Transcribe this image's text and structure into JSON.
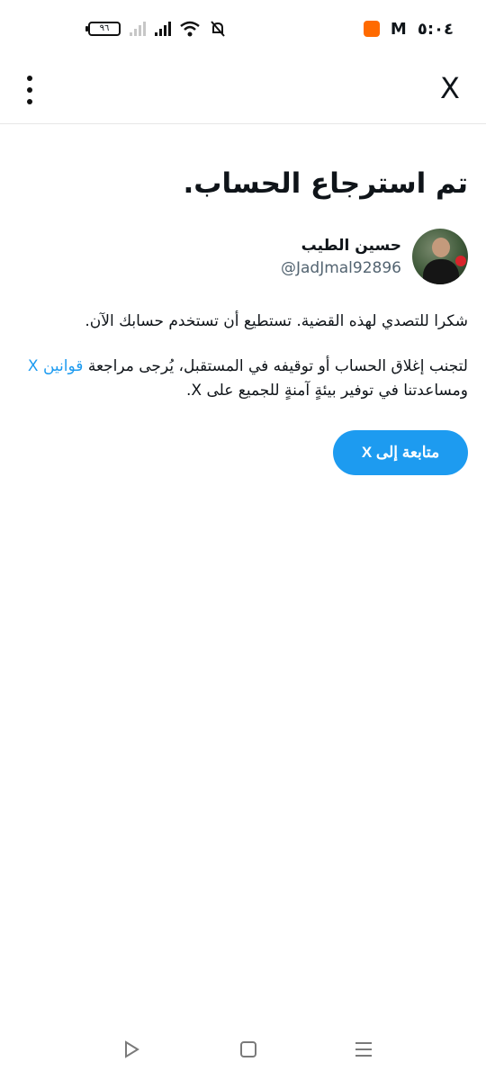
{
  "status_bar": {
    "battery_level": "٩٦",
    "time": "٥:٠٤",
    "icons": [
      "battery-icon",
      "signal-icon",
      "signal-icon",
      "wifi-icon",
      "mute-icon",
      "gmail-icon",
      "app-icon"
    ]
  },
  "top_bar": {
    "close_label": "X",
    "menu_icon": "more-vertical-icon"
  },
  "main": {
    "title": "تم استرجاع الحساب.",
    "account": {
      "display_name": "حسين الطيب",
      "handle": "@JadJmal92896"
    },
    "paragraph1": "شكرا للتصدي لهذه القضية. تستطيع أن تستخدم حسابك الآن.",
    "paragraph2_part1": "لتجنب إغلاق الحساب أو توقيفه في المستقبل، يُرجى مراجعة ",
    "paragraph2_link": "قوانين X",
    "paragraph2_part2": " ومساعدتنا في توفير بيئةٍ آمنةٍ للجميع على X.",
    "continue_button": "متابعة إلى X"
  },
  "nav_bar": {
    "icons": [
      "back-icon",
      "home-icon",
      "recents-icon"
    ]
  },
  "colors": {
    "accent": "#1d9bf0",
    "text": "#0f1419",
    "secondary_text": "#536471"
  }
}
